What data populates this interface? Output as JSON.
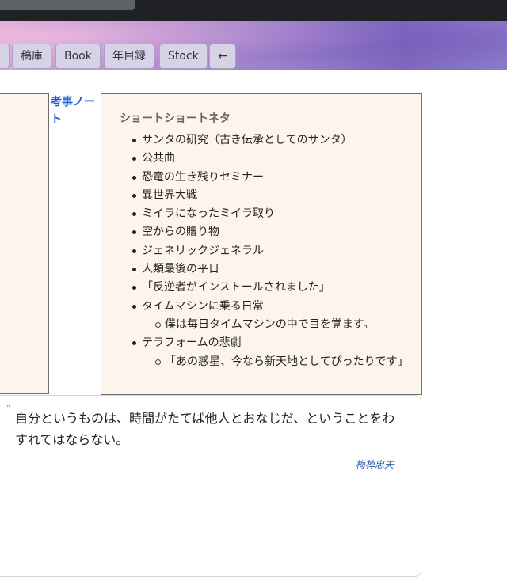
{
  "nav": {
    "buttons": [
      "稿庫",
      "Book",
      "年目録",
      "Stock",
      "←"
    ]
  },
  "sidebar": {
    "link_label": "考事ノート"
  },
  "ideas": {
    "title": "ショートショートネタ",
    "items": [
      {
        "label": "サンタの研究（古き伝承としてのサンタ）"
      },
      {
        "label": "公共曲"
      },
      {
        "label": "恐竜の生き残りセミナー"
      },
      {
        "label": "異世界大戦"
      },
      {
        "label": "ミイラになったミイラ取り"
      },
      {
        "label": "空からの贈り物"
      },
      {
        "label": "ジェネリックジェネラル"
      },
      {
        "label": "人類最後の平日"
      },
      {
        "label": "「反逆者がインストールされました」"
      },
      {
        "label": "タイムマシンに乗る日常",
        "sub": "僕は毎日タイムマシンの中で目を覚ます。"
      },
      {
        "label": "テラフォームの悲劇",
        "sub": "「あの惑星、今なら新天地としてぴったりです」"
      }
    ]
  },
  "quote": {
    "mark": "”",
    "text": "自分というものは、時間がたてば他人とおなじだ、ということをわすれてはならない。",
    "author": "梅棹忠夫"
  },
  "colors": {
    "panel_bg": "#fdf5ec",
    "link": "#1a5fd0",
    "topbar": "#202124"
  }
}
